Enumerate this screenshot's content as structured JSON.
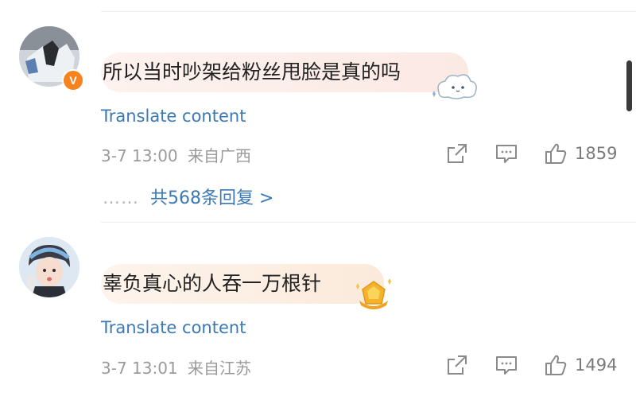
{
  "comments": [
    {
      "text": "所以当时吵架给粉丝甩脸是真的吗",
      "translate": "Translate content",
      "date": "3-7 13:00",
      "location": "来自广西",
      "likes": "1859",
      "replies_label": "共568条回复 >",
      "dots": "……",
      "verified_badge": "V",
      "bubble_color": "#fbeeea"
    },
    {
      "text": "辜负真心的人吞一万根针",
      "translate": "Translate content",
      "date": "3-7 13:01",
      "location": "来自江苏",
      "likes": "1494",
      "bubble_color": "#fcf0e4"
    }
  ],
  "icons": [
    "share-icon",
    "comment-icon",
    "like-icon"
  ]
}
